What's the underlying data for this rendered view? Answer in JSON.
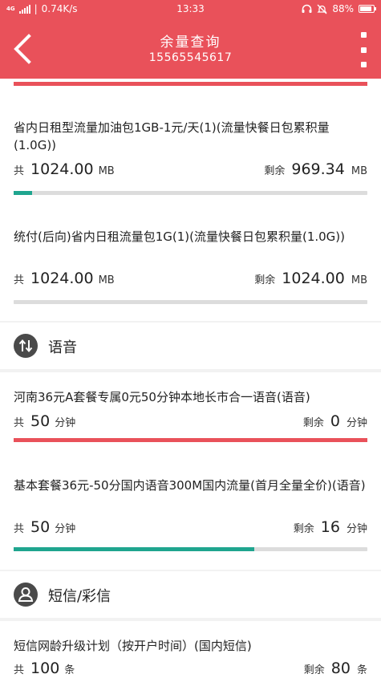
{
  "status_bar": {
    "network": "4G",
    "speed": "0.74K/s",
    "time": "13:33",
    "battery": "88%",
    "icons": [
      "signal-icon",
      "headset-icon",
      "mute-icon",
      "battery-icon"
    ]
  },
  "header": {
    "title": "余量查询",
    "phone": "15565545617",
    "back_icon": "chevron-left-icon",
    "menu_icon": "more-vertical-icon"
  },
  "colors": {
    "accent": "#e9515a",
    "teal": "#1fa58f",
    "track": "#dcdcdc"
  },
  "data_items": [
    {
      "name": "省内日租型流量加油包1GB-1元/天(1)(流量快餐日包累积量(1.0G))",
      "total_prefix": "共",
      "total": "1024.00",
      "total_unit": "MB",
      "remain_prefix": "剩余",
      "remain": "969.34",
      "remain_unit": "MB",
      "used_fraction": 0.053,
      "bar_color": "#1fa58f"
    },
    {
      "name": "统付(后向)省内日租流量包1G(1)(流量快餐日包累积量(1.0G))",
      "total_prefix": "共",
      "total": "1024.00",
      "total_unit": "MB",
      "remain_prefix": "剩余",
      "remain": "1024.00",
      "remain_unit": "MB",
      "used_fraction": 0,
      "bar_color": "#1fa58f"
    }
  ],
  "voice_section": {
    "title": "语音",
    "icon": "swap-arrows-icon",
    "items": [
      {
        "name": "河南36元A套餐专属0元50分钟本地长市合一语音(语音)",
        "total_prefix": "共",
        "total": "50",
        "total_unit": "分钟",
        "remain_prefix": "剩余",
        "remain": "0",
        "remain_unit": "分钟",
        "used_fraction": 1,
        "bar_color": "#e9515a"
      },
      {
        "name": "基本套餐36元-50分国内语音300M国内流量(首月全量全价)(语音)",
        "total_prefix": "共",
        "total": "50",
        "total_unit": "分钟",
        "remain_prefix": "剩余",
        "remain": "16",
        "remain_unit": "分钟",
        "used_fraction": 0.68,
        "bar_color": "#1fa58f"
      }
    ]
  },
  "sms_section": {
    "title": "短信/彩信",
    "icon": "person-icon",
    "items": [
      {
        "name": "短信网龄升级计划（按开户时间）(国内短信)",
        "total_prefix": "共",
        "total": "100",
        "total_unit": "条",
        "remain_prefix": "剩余",
        "remain": "80",
        "remain_unit": "条"
      }
    ]
  }
}
